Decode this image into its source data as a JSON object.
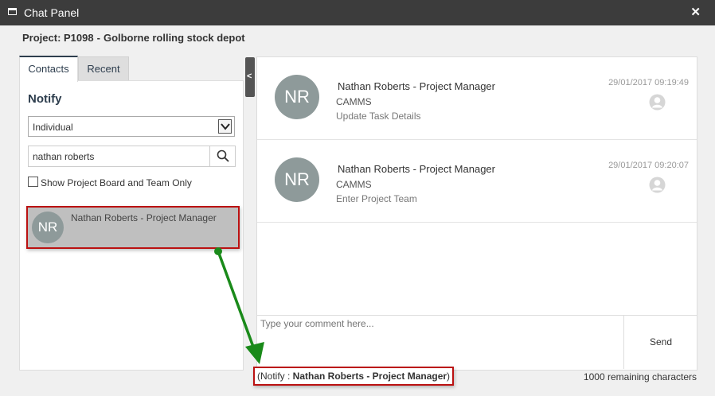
{
  "window": {
    "title": "Chat Panel",
    "close_glyph": "✕"
  },
  "project": {
    "label": "Project: P1098",
    "separator": "-",
    "name": "Golborne rolling stock depot"
  },
  "tabs": [
    {
      "label": "Contacts",
      "active": true
    },
    {
      "label": "Recent",
      "active": false
    }
  ],
  "notify": {
    "heading": "Notify",
    "select_value": "Individual",
    "search_value": "nathan roberts",
    "checkbox_label": "Show Project Board and Team Only",
    "checkbox_checked": false
  },
  "contacts": [
    {
      "initials": "NR",
      "name": "Nathan Roberts - Project Manager"
    }
  ],
  "collapse_glyph": "<",
  "messages": [
    {
      "initials": "NR",
      "sender": "Nathan Roberts - Project Manager",
      "org": "CAMMS",
      "action": "Update Task Details",
      "timestamp": "29/01/2017 09:19:49"
    },
    {
      "initials": "NR",
      "sender": "Nathan Roberts - Project Manager",
      "org": "CAMMS",
      "action": "Enter Project Team",
      "timestamp": "29/01/2017 09:20:07"
    }
  ],
  "comment": {
    "placeholder": "Type your comment here...",
    "send_label": "Send"
  },
  "footer": {
    "notify_open": "(Notify : ",
    "notify_name": "Nathan Roberts - Project Manager",
    "notify_close": ")",
    "remaining": "1000 remaining characters"
  },
  "colors": {
    "titlebar": "#3c3c3c",
    "highlight_border": "#bb1111",
    "arrow": "#1a8a1a",
    "avatar": "#8e9a9a"
  }
}
